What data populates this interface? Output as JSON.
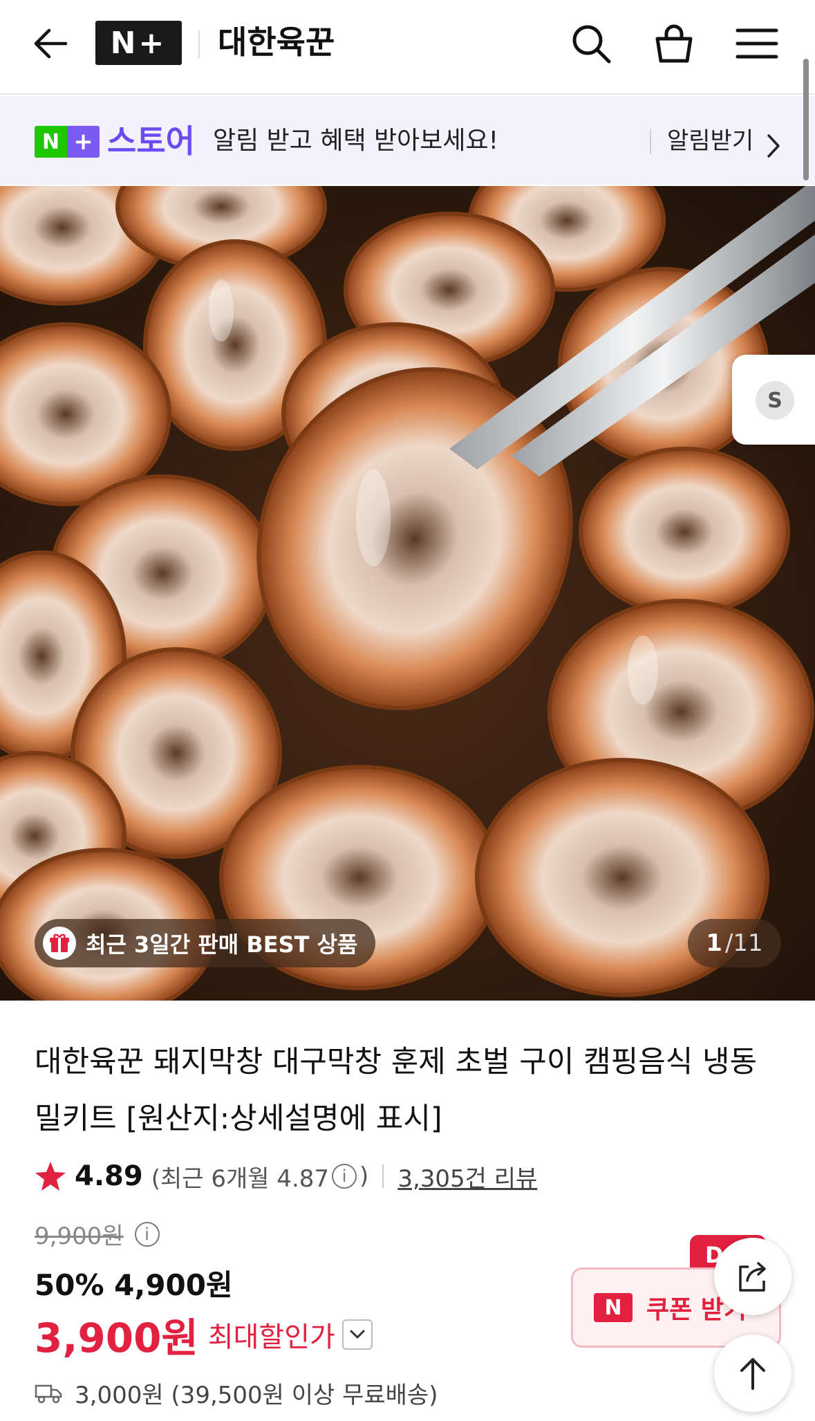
{
  "header": {
    "logo_text": "N+",
    "store_name": "대한육꾼"
  },
  "promo": {
    "np_n": "N",
    "np_plus": "+",
    "store_label": "스토어",
    "message": "알림 받고 혜택 받아보세요!",
    "alert_label": "알림받기"
  },
  "gallery": {
    "best_badge": "최근 3일간 판매 BEST 상품",
    "current": "1",
    "total": "/11",
    "side_tab": "S"
  },
  "product": {
    "title": "대한육꾼 돼지막창 대구막창 훈제 초벌 구이 캠핑음식 냉동 밀키트 [원산지:상세설명에 표시]",
    "rating": "4.89",
    "recent_rating_prefix": "(최근 6개월 4.87",
    "recent_rating_suffix": ")",
    "review_count": "3,305건 리뷰",
    "original_price": "9,900원",
    "discount_line": "50% 4,900원",
    "final_price": "3,900원",
    "max_discount_label": "최대할인가",
    "shipping": "3,000원 (39,500원 이상 무료배송)"
  },
  "coupon": {
    "n_label": "N",
    "label": "쿠폰 받기",
    "badge": "D"
  },
  "colors": {
    "accent_red": "#e2203f",
    "naver_green": "#1ec800",
    "store_purple": "#6a4cf2",
    "banner_bg": "#f3f1fc"
  }
}
